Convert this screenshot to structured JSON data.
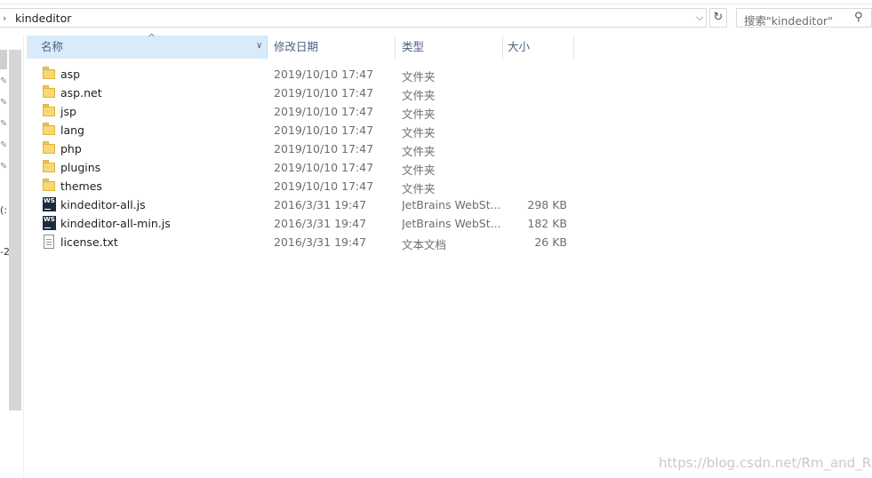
{
  "address_bar": {
    "path": "kindeditor"
  },
  "search": {
    "placeholder": "搜索\"kindeditor\""
  },
  "columns": {
    "name": "名称",
    "date": "修改日期",
    "type": "类型",
    "size": "大小"
  },
  "files": [
    {
      "name": "asp",
      "date": "2019/10/10 17:47",
      "type": "文件夹",
      "size": "",
      "icon": "folder-icon"
    },
    {
      "name": "asp.net",
      "date": "2019/10/10 17:47",
      "type": "文件夹",
      "size": "",
      "icon": "folder-icon"
    },
    {
      "name": "jsp",
      "date": "2019/10/10 17:47",
      "type": "文件夹",
      "size": "",
      "icon": "folder-icon"
    },
    {
      "name": "lang",
      "date": "2019/10/10 17:47",
      "type": "文件夹",
      "size": "",
      "icon": "folder-icon"
    },
    {
      "name": "php",
      "date": "2019/10/10 17:47",
      "type": "文件夹",
      "size": "",
      "icon": "folder-icon"
    },
    {
      "name": "plugins",
      "date": "2019/10/10 17:47",
      "type": "文件夹",
      "size": "",
      "icon": "folder-icon"
    },
    {
      "name": "themes",
      "date": "2019/10/10 17:47",
      "type": "文件夹",
      "size": "",
      "icon": "folder-icon"
    },
    {
      "name": "kindeditor-all.js",
      "date": "2016/3/31 19:47",
      "type": "JetBrains WebSt...",
      "size": "298 KB",
      "icon": "webstorm-file-icon"
    },
    {
      "name": "kindeditor-all-min.js",
      "date": "2016/3/31 19:47",
      "type": "JetBrains WebSt...",
      "size": "182 KB",
      "icon": "webstorm-file-icon"
    },
    {
      "name": "license.txt",
      "date": "2016/3/31 19:47",
      "type": "文本文档",
      "size": "26 KB",
      "icon": "text-file-icon"
    }
  ],
  "nav_fragments": [
    "(:",
    "-2"
  ],
  "watermark": "https://blog.csdn.net/Rm_and_Rf",
  "colors": {
    "header_selected": "#d9ebf9",
    "folder": "#f8d775",
    "header_text": "#4d6082"
  }
}
